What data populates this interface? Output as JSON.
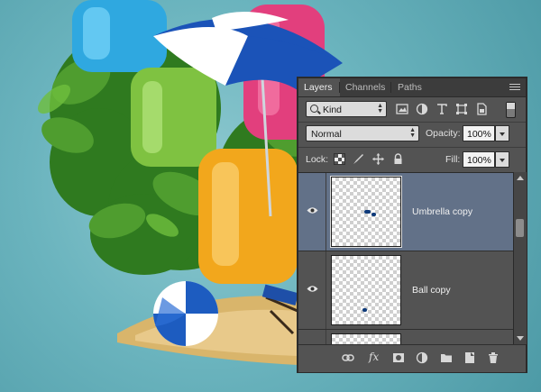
{
  "panel": {
    "tabs": [
      {
        "label": "Layers",
        "active": true
      },
      {
        "label": "Channels",
        "active": false
      },
      {
        "label": "Paths",
        "active": false
      }
    ],
    "menu_icon": "panel-menu-icon",
    "filter": {
      "kind_label": "Kind",
      "icons": [
        "pixel-filter-icon",
        "adjustment-filter-icon",
        "type-filter-icon",
        "shape-filter-icon",
        "smart-object-filter-icon"
      ]
    },
    "blend_mode": "Normal",
    "opacity_label": "Opacity:",
    "opacity_value": "100%",
    "lock_label": "Lock:",
    "lock_icons": [
      "lock-transparent-icon",
      "lock-image-icon",
      "lock-position-icon",
      "lock-all-icon"
    ],
    "fill_label": "Fill:",
    "fill_value": "100%",
    "layers": [
      {
        "name": "Umbrella copy",
        "visible": true,
        "selected": true
      },
      {
        "name": "Ball copy",
        "visible": true,
        "selected": false
      },
      {
        "name": "",
        "visible": false,
        "selected": false
      }
    ],
    "bottom_icons": [
      "link-icon",
      "fx-icon",
      "mask-icon",
      "adjustment-layer-icon",
      "folder-icon",
      "new-layer-icon",
      "trash-icon"
    ],
    "bottom_fx_label": "fx"
  },
  "colors": {
    "panel_bg": "#535353",
    "selected_layer": "#627188",
    "canvas_bg": "#6bb4be"
  }
}
